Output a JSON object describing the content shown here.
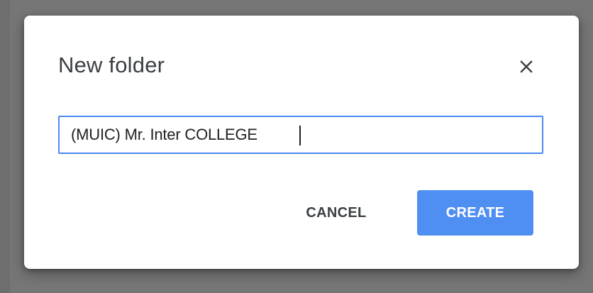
{
  "dialog": {
    "title": "New folder",
    "close_icon": "close-icon",
    "folder_name": {
      "value": "(MUIC) Mr. Inter COLLEGE",
      "placeholder": ""
    },
    "cancel_label": "CANCEL",
    "create_label": "CREATE"
  },
  "colors": {
    "backdrop": "#767676",
    "dialog_bg": "#ffffff",
    "accent": "#4f8ff2",
    "input_border": "#4a8af4",
    "title_text": "#3c4043"
  }
}
